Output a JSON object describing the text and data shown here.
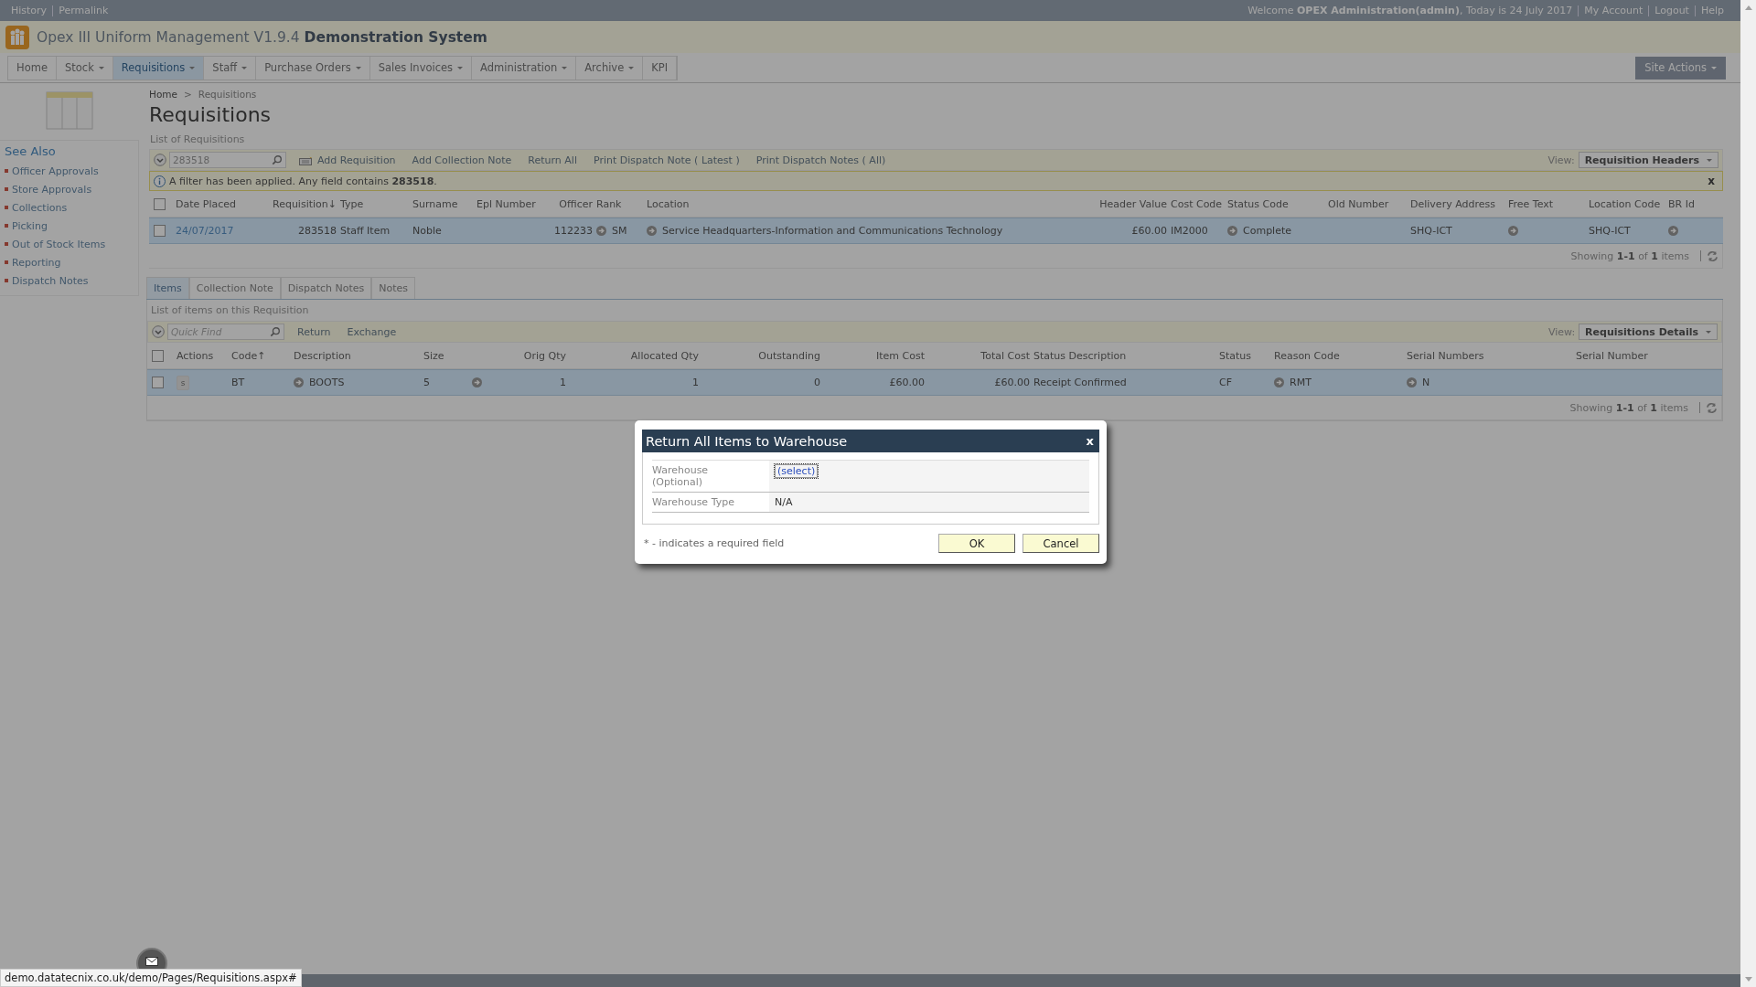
{
  "top_bar": {
    "left_links": [
      "History",
      "Permalink"
    ],
    "welcome": "Welcome **OPEX Administration(admin)**, Today is 24 July 2017",
    "right_links": [
      "My Account",
      "Logout",
      "Help"
    ]
  },
  "header": {
    "title": "Opex III Uniform Management V1.9.4",
    "title_bold": "Demonstration System"
  },
  "nav": [
    {
      "label": "Home",
      "dropdown": false,
      "selected": false
    },
    {
      "label": "Stock",
      "dropdown": true,
      "selected": false
    },
    {
      "label": "Requisitions",
      "dropdown": true,
      "selected": true
    },
    {
      "label": "Staff",
      "dropdown": true,
      "selected": false
    },
    {
      "label": "Purchase Orders",
      "dropdown": true,
      "selected": false
    },
    {
      "label": "Sales Invoices",
      "dropdown": true,
      "selected": false
    },
    {
      "label": "Administration",
      "dropdown": true,
      "selected": false
    },
    {
      "label": "Archive",
      "dropdown": true,
      "selected": false
    },
    {
      "label": "KPI",
      "dropdown": false,
      "selected": false
    }
  ],
  "site_actions": "Site Actions",
  "sidebar": {
    "title": "See Also",
    "items": [
      "Officer Approvals",
      "Store Approvals",
      "Collections",
      "Picking",
      "Out of Stock Items",
      "Reporting",
      "Dispatch Notes"
    ]
  },
  "breadcrumb": {
    "items": [
      "Home",
      "Requisitions"
    ],
    "separator": ">"
  },
  "page_title": "Requisitions",
  "requisitions": {
    "caption": "List of Requisitions",
    "search_value": "283518",
    "actions": [
      {
        "label": "Add Requisition",
        "kind": "add"
      },
      {
        "label": "Add Collection Note",
        "kind": "plain"
      },
      {
        "label": "Return All",
        "kind": "plain"
      },
      {
        "label": "Print Dispatch Note ( Latest )",
        "kind": "plain"
      },
      {
        "label": "Print Dispatch Notes ( All)",
        "kind": "plain"
      }
    ],
    "view_label": "View:",
    "view_value": "Requisition Headers",
    "filter_message": "A filter has been applied. Any field contains **283518**.",
    "filter_close": "x",
    "select_all_checked": false,
    "columns": [
      "Date Placed",
      "Requisition↓",
      "Type",
      "Surname",
      "Epl Number",
      "Officer",
      "Rank",
      "Location",
      "Header Value",
      "Cost Code",
      "Status Code",
      "Old Number",
      "Delivery Address",
      "Free Text",
      "Location Code",
      "BR Id"
    ],
    "rows": [
      {
        "selected": true,
        "checked": false,
        "cells": [
          {
            "text": "24/07/2017"
          },
          {
            "text": "283518"
          },
          {
            "text": "Staff Item"
          },
          {
            "text": "Noble"
          },
          {
            "text": ""
          },
          {
            "text": "112233"
          },
          {
            "text": "SM",
            "arrow_before": true
          },
          {
            "text": "Service Headquarters-Information and Communications Technology",
            "arrow_before": true
          },
          {
            "text": "£60.00"
          },
          {
            "text": "IM2000"
          },
          {
            "text": "Complete",
            "arrow_before": true
          },
          {
            "text": ""
          },
          {
            "text": "SHQ-ICT"
          },
          {
            "text": "",
            "arrow_before": true
          },
          {
            "text": "SHQ-ICT"
          },
          {
            "text": "",
            "arrow_before": true
          }
        ]
      }
    ],
    "footer": "Showing **1-1** of **1** items"
  },
  "tabs": [
    {
      "label": "Items",
      "selected": true
    },
    {
      "label": "Collection Note",
      "selected": false
    },
    {
      "label": "Dispatch Notes",
      "selected": false
    },
    {
      "label": "Notes",
      "selected": false
    }
  ],
  "items": {
    "caption": "List of items on this Requisition",
    "search_placeholder": "Quick Find",
    "actions": [
      "Return",
      "Exchange"
    ],
    "view_label": "View:",
    "view_value": "Requisitions Details",
    "select_all_checked": false,
    "columns": [
      "Actions",
      "Code↑",
      "Description",
      "Size",
      "Orig Qty",
      "Allocated Qty",
      "Outstanding",
      "Item Cost",
      "Total Cost",
      "Status Description",
      "Status",
      "Reason Code",
      "Serial Numbers",
      "Serial Number"
    ],
    "rows": [
      {
        "selected": true,
        "checked": false,
        "cells": [
          {
            "text": "s",
            "kind": "action"
          },
          {
            "text": "BT"
          },
          {
            "text": "BOOTS",
            "arrow_before": true
          },
          {
            "text": "5",
            "arrow_after": true
          },
          {
            "text": "1"
          },
          {
            "text": "1"
          },
          {
            "text": "0"
          },
          {
            "text": "£60.00"
          },
          {
            "text": "£60.00"
          },
          {
            "text": "Receipt Confirmed"
          },
          {
            "text": "CF"
          },
          {
            "text": "RMT",
            "arrow_before": true
          },
          {
            "text": "N",
            "arrow_before": true
          },
          {
            "text": ""
          }
        ]
      }
    ],
    "footer": "Showing **1-1** of **1** items"
  },
  "dialog": {
    "title": "Return All Items to Warehouse",
    "close": "x",
    "fields": [
      {
        "label": "Warehouse (Optional)",
        "kind": "select",
        "value": "(select)"
      },
      {
        "label": "Warehouse Type",
        "kind": "text",
        "value": "N/A"
      }
    ],
    "note": "* - indicates a required field",
    "buttons": [
      "OK",
      "Cancel"
    ]
  },
  "status_url": "demo.datatecnix.co.uk/demo/Pages/Requisitions.aspx#"
}
